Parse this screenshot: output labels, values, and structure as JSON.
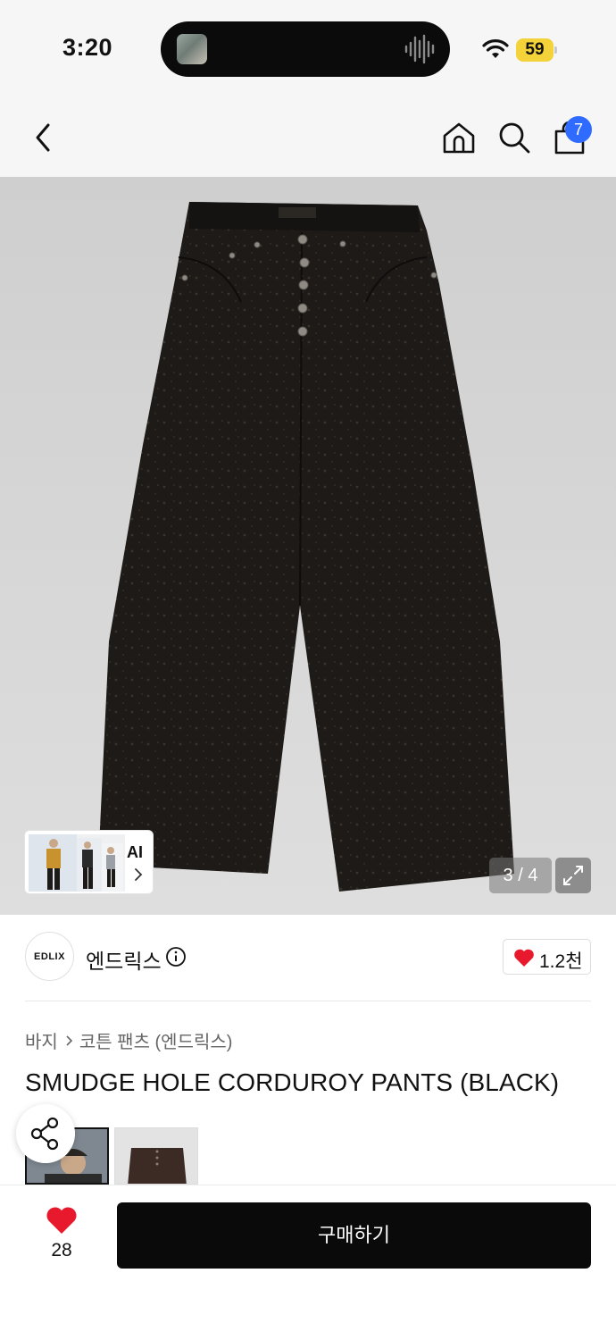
{
  "status_bar": {
    "time": "3:20",
    "battery": "59"
  },
  "nav": {
    "cart_count": "7"
  },
  "gallery": {
    "page_counter": "3 / 4",
    "ai_label": "AI"
  },
  "brand": {
    "logo_text": "EDLIX",
    "name": "엔드릭스",
    "likes": "1.2천"
  },
  "breadcrumb": {
    "category": "바지",
    "subcategory": "코튼 팬츠 (엔드릭스)"
  },
  "product": {
    "title": "SMUDGE HOLE CORDUROY PANTS (BLACK)"
  },
  "bottom_bar": {
    "wish_count": "28",
    "buy_label": "구매하기"
  },
  "colors": {
    "accent_blue": "#2f6bff",
    "heart_red": "#e8192c",
    "buy_button": "#0a0a0a",
    "battery": "#f4d23a"
  }
}
